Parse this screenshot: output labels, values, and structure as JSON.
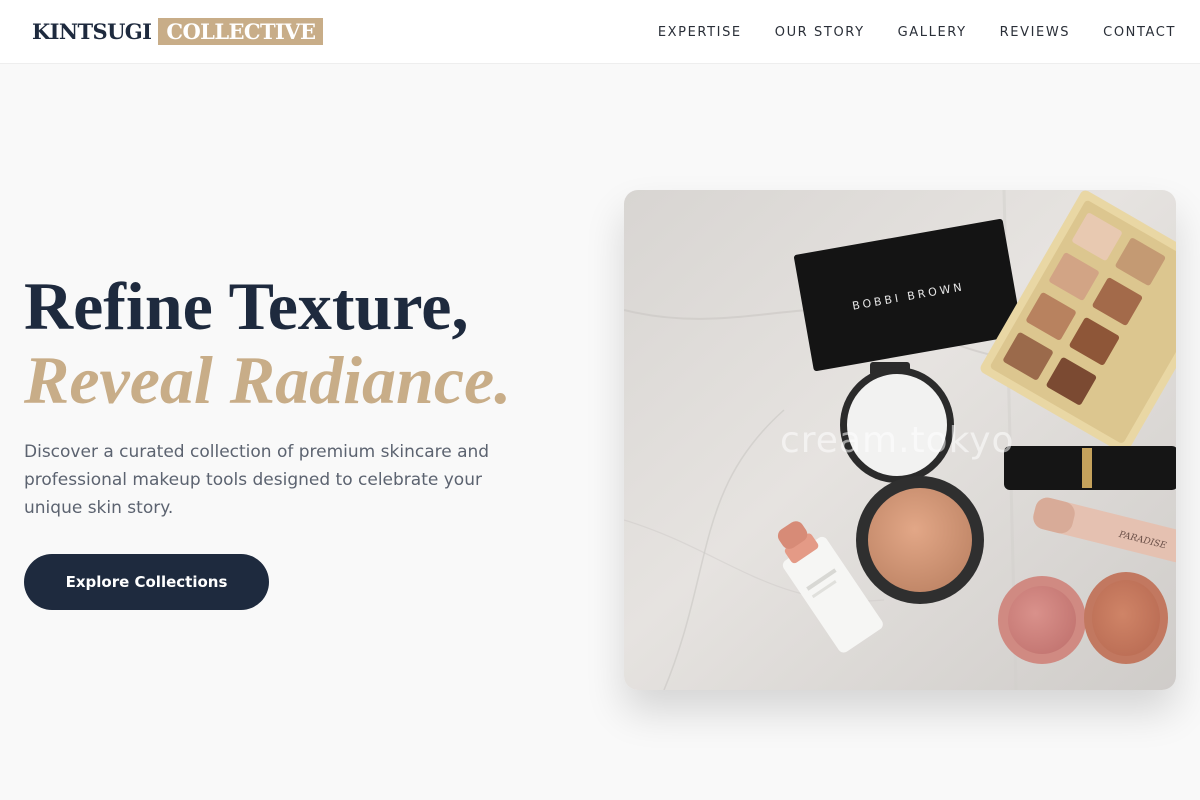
{
  "brand": {
    "name_primary": "KINTSUGI",
    "name_secondary": "COLLECTIVE"
  },
  "nav": {
    "items": [
      "EXPERTISE",
      "OUR STORY",
      "GALLERY",
      "REVIEWS",
      "CONTACT"
    ]
  },
  "hero": {
    "headline_line1": "Refine Texture,",
    "headline_line2": "Reveal Radiance.",
    "intro": "Discover a curated collection of premium skincare and professional makeup tools designed to celebrate your unique skin story.",
    "cta_label": "Explore Collections",
    "image": {
      "watermark": "cream.tokyo",
      "compact_brand": "BOBBI BROWN",
      "mascara_brand": "PARADISE"
    }
  },
  "colors": {
    "navy": "#1e2a3e",
    "gold": "#c8ad88",
    "background": "#f9f9f9",
    "body_text": "#5c6370"
  },
  "icons": {
    "logo": "wordmark-logo"
  }
}
